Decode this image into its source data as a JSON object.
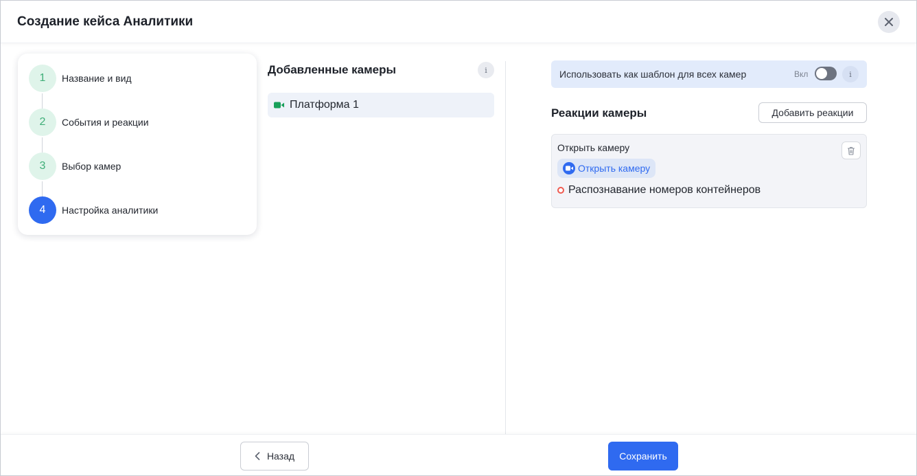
{
  "dialog": {
    "title": "Создание кейса Аналитики",
    "close_icon": "close-icon"
  },
  "stepper": {
    "steps": [
      {
        "number": "1",
        "label": "Название и вид",
        "state": "done"
      },
      {
        "number": "2",
        "label": "События и реакции",
        "state": "done"
      },
      {
        "number": "3",
        "label": "Выбор камер",
        "state": "done"
      },
      {
        "number": "4",
        "label": "Настройка аналитики",
        "state": "active"
      }
    ]
  },
  "cameras": {
    "title": "Добавленные камеры",
    "info_glyph": "i",
    "items": [
      {
        "label": "Платформа 1",
        "icon": "video-camera-icon"
      }
    ]
  },
  "template": {
    "text": "Использовать как шаблон для всех камер",
    "toggle_label": "Вкл",
    "toggle_on": false,
    "info_glyph": "i"
  },
  "reactions": {
    "title": "Реакции камеры",
    "add_label": "Добавить реакции",
    "items": [
      {
        "name": "Открыть камеру",
        "chip_label": "Открыть камеру",
        "chip_icon": "video-camera-icon",
        "event": "Распознавание номеров контейнеров",
        "event_icon": "circle-icon"
      }
    ]
  },
  "footer": {
    "back_label": "Назад",
    "save_label": "Сохранить"
  },
  "colors": {
    "accent": "#2f6af0",
    "done_step_bg": "#dff4ea",
    "done_step_text": "#3fae78",
    "camera_icon": "#18a05a",
    "event_dot": "#ef5a50"
  }
}
